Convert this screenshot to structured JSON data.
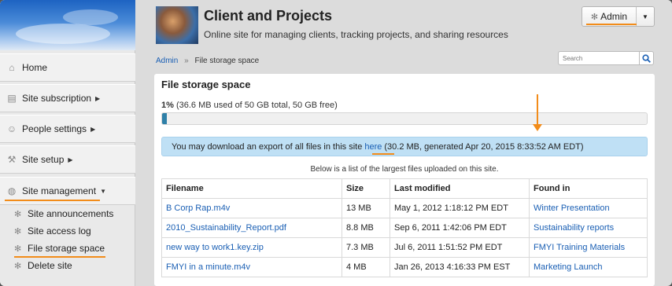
{
  "header": {
    "site_title": "Client and Projects",
    "site_description": "Online site for managing clients, tracking projects, and sharing resources",
    "admin_button_label": "Admin"
  },
  "breadcrumb": {
    "root": "Admin",
    "separator": "»",
    "current": "File storage space"
  },
  "search": {
    "placeholder": "Search"
  },
  "sidebar": {
    "items": [
      {
        "label": "Home",
        "icon": "home-icon"
      },
      {
        "label": "Site subscription",
        "icon": "document-icon"
      },
      {
        "label": "People settings",
        "icon": "people-icon"
      },
      {
        "label": "Site setup",
        "icon": "wrench-icon"
      },
      {
        "label": "Site management",
        "icon": "globe-icon"
      }
    ],
    "sub_items": [
      {
        "label": "Site announcements",
        "icon": "gear-icon"
      },
      {
        "label": "Site access log",
        "icon": "gear-icon"
      },
      {
        "label": "File storage space",
        "icon": "gear-icon"
      },
      {
        "label": "Delete site",
        "icon": "gear-icon"
      }
    ]
  },
  "storage": {
    "title": "File storage space",
    "usage_percent": "1%",
    "usage_detail": "(36.6 MB used of 50 GB total, 50 GB free)",
    "usage_fraction": 0.01,
    "notice_prefix": "You may download an export of all files in this site",
    "notice_link": "here",
    "notice_suffix": "(30.2 MB, generated Apr 20, 2015 8:33:52 AM EDT)",
    "table_caption": "Below is a list of the largest files uploaded on this site.",
    "columns": [
      "Filename",
      "Size",
      "Last modified",
      "Found in"
    ],
    "rows": [
      {
        "filename": "B Corp Rap.m4v",
        "size": "13 MB",
        "modified": "May 1, 2012 1:18:12 PM EDT",
        "found_in": "Winter Presentation"
      },
      {
        "filename": "2010_Sustainability_Report.pdf",
        "size": "8.8 MB",
        "modified": "Sep 6, 2011 1:42:06 PM EDT",
        "found_in": "Sustainability reports"
      },
      {
        "filename": "new way to work1.key.zip",
        "size": "7.3 MB",
        "modified": "Jul 6, 2011 1:51:52 PM EDT",
        "found_in": "FMYI Training Materials"
      },
      {
        "filename": "FMYI in a minute.m4v",
        "size": "4 MB",
        "modified": "Jan 26, 2013 4:16:33 PM EST",
        "found_in": "Marketing Launch"
      }
    ]
  },
  "colors": {
    "accent": "#f28c1a",
    "link": "#1a5fb4",
    "notice_bg": "#bfe0f5",
    "progress_fill": "#2f80a8"
  }
}
